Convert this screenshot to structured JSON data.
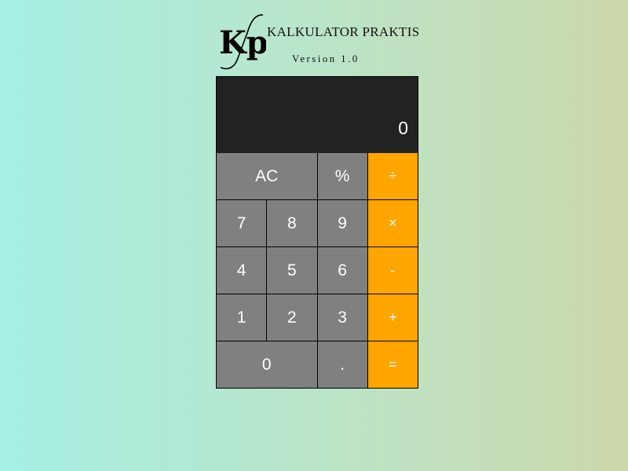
{
  "header": {
    "logo": "Kp",
    "title": "KALKULATOR PRAKTIS",
    "version": "Version 1.0"
  },
  "display": {
    "value": "0"
  },
  "keys": {
    "clear": "AC",
    "percent": "%",
    "divide": "÷",
    "seven": "7",
    "eight": "8",
    "nine": "9",
    "multiply": "×",
    "four": "4",
    "five": "5",
    "six": "6",
    "subtract": "-",
    "one": "1",
    "two": "2",
    "three": "3",
    "add": "+",
    "zero": "0",
    "decimal": ".",
    "equals": "="
  },
  "colors": {
    "display_bg": "#222222",
    "key_bg": "#808080",
    "operator_bg": "#ffa500",
    "key_text": "#ffffff"
  }
}
